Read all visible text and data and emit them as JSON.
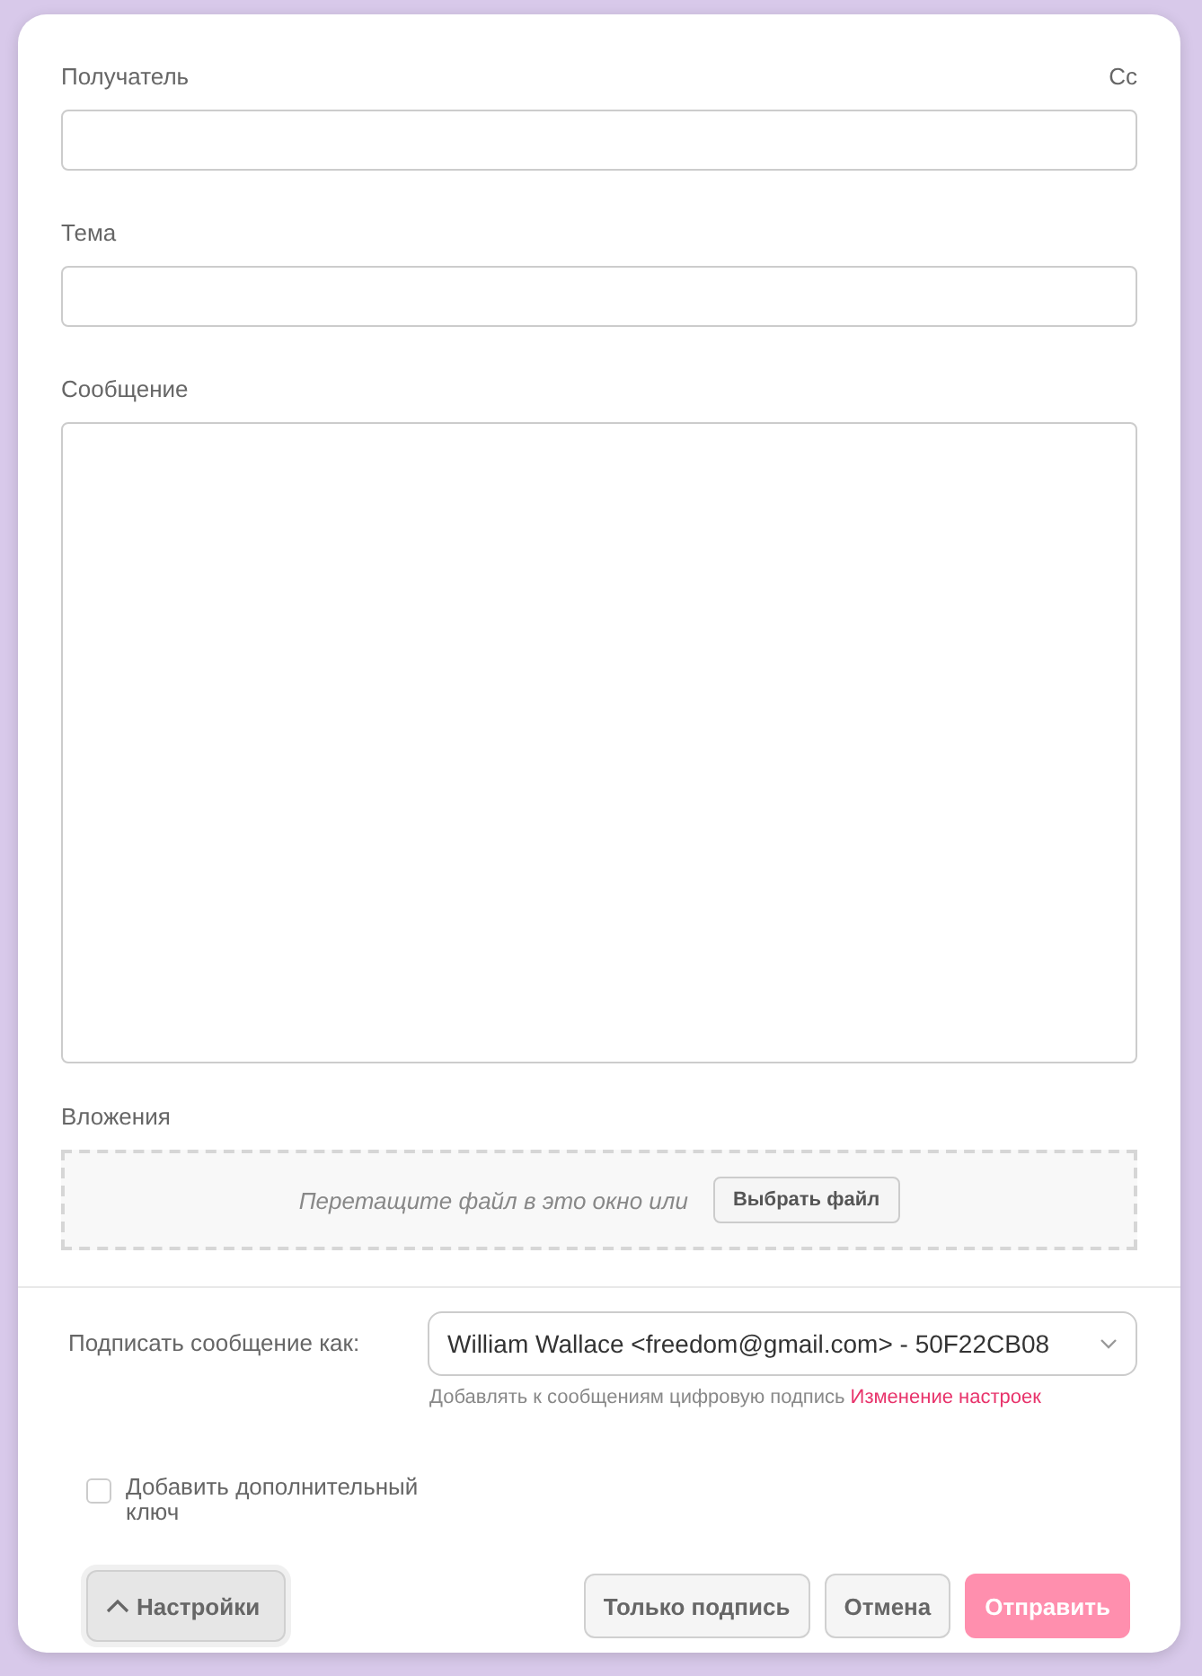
{
  "recipient": {
    "label": "Получатель",
    "cc": "Cc"
  },
  "subject": {
    "label": "Тема"
  },
  "message": {
    "label": "Сообщение"
  },
  "attachments": {
    "label": "Вложения",
    "hint": "Перетащите файл в это окно или",
    "button": "Выбрать файл"
  },
  "signature": {
    "label": "Подписать сообщение как:",
    "value": "William Wallace <freedom@gmail.com> - 50F22CB08",
    "note": "Добавлять к сообщениям цифровую подпись",
    "link": "Изменение настроек"
  },
  "extra_key": {
    "label": "Добавить дополнительный ключ",
    "checked": false
  },
  "settings_button": {
    "label": "Настройки"
  },
  "buttons": [
    {
      "label": "Только подпись",
      "kind": "secondary"
    },
    {
      "label": "Отмена",
      "kind": "secondary"
    },
    {
      "label": "Отправить",
      "kind": "primary"
    }
  ]
}
